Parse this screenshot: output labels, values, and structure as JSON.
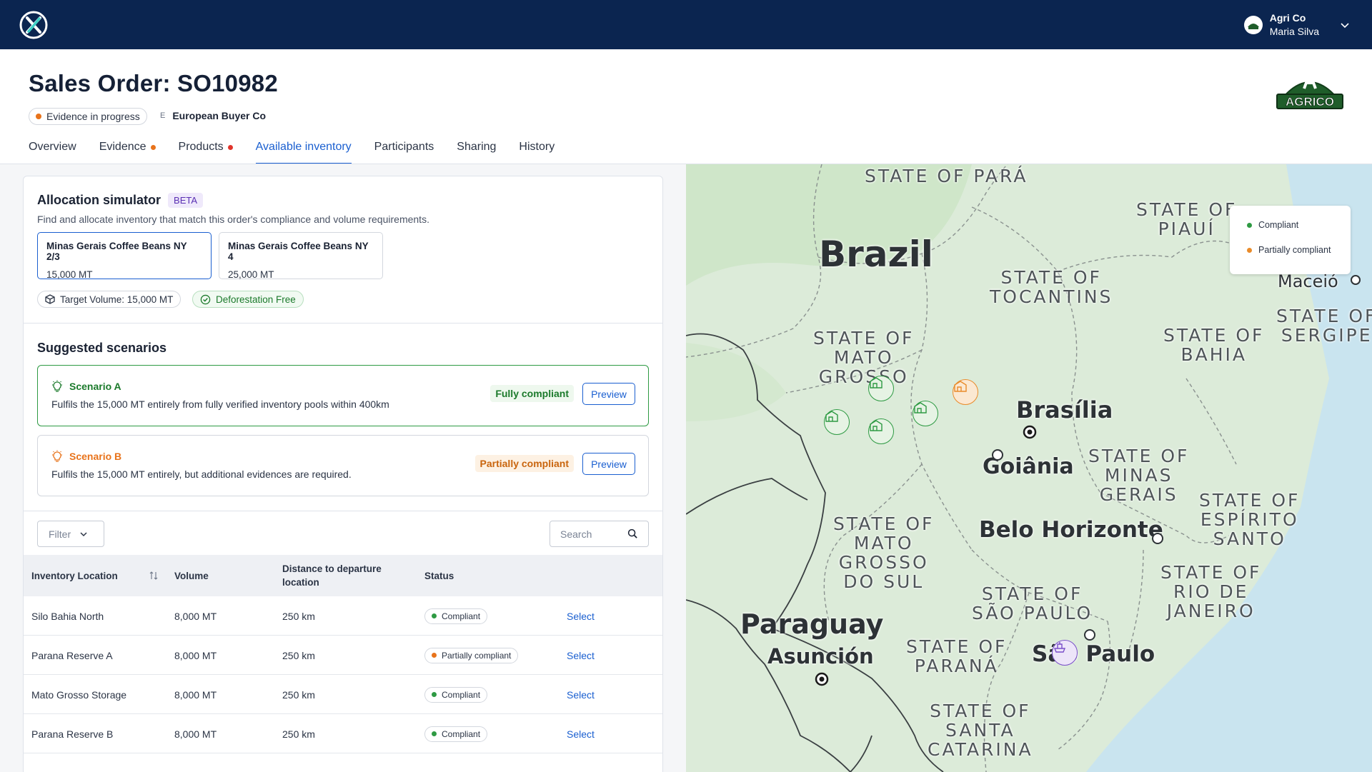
{
  "topbar": {
    "org_name": "Agri Co",
    "user_name": "Maria Silva",
    "icons": [
      "app-logo-icon",
      "org-avatar-icon",
      "chevron-down-icon"
    ]
  },
  "header": {
    "title": "Sales Order: SO10982",
    "status_label": "Evidence in progress",
    "status_color": "#e8731b",
    "buyer_initial": "E",
    "buyer_name": "European Buyer Co",
    "brand_logo_text": "AGRICO"
  },
  "tabs": [
    {
      "label": "Overview",
      "dot": null
    },
    {
      "label": "Evidence",
      "dot": "#e8731b"
    },
    {
      "label": "Products",
      "dot": "#e0342b"
    },
    {
      "label": "Available inventory",
      "dot": null,
      "active": true
    },
    {
      "label": "Participants",
      "dot": null
    },
    {
      "label": "Sharing",
      "dot": null
    },
    {
      "label": "History",
      "dot": null
    }
  ],
  "simulator": {
    "title": "Allocation simulator",
    "badge": "BETA",
    "description": "Find and allocate inventory that match this order's compliance and volume requirements.",
    "products": [
      {
        "name": "Minas Gerais Coffee Beans NY 2/3",
        "volume": "15,000 MT",
        "selected": true
      },
      {
        "name": "Minas Gerais Coffee Beans NY 4",
        "volume": "25,000 MT",
        "selected": false
      }
    ],
    "target_volume": "Target Volume: 15,000 MT",
    "deforestation": "Deforestation Free"
  },
  "suggested": {
    "title": "Suggested scenarios",
    "scenarios": [
      {
        "name": "Scenario A",
        "description": "Fulfils the 15,000 MT entirely from fully verified inventory pools within 400km",
        "compliance": "Fully compliant",
        "preview": "Preview",
        "color": "#1b7a2b"
      },
      {
        "name": "Scenario B",
        "description": "Fulfils the 15,000 MT entirely, but additional evidences are required.",
        "compliance": "Partially compliant",
        "preview": "Preview",
        "color": "#e8731b"
      }
    ]
  },
  "inventory": {
    "filter_label": "Filter",
    "search_placeholder": "Search",
    "columns": [
      "Inventory Location",
      "Volume",
      "Distance to departure location",
      "Status"
    ],
    "rows": [
      {
        "location": "Silo Bahia North",
        "volume": "8,000 MT",
        "distance": "250 km",
        "status": "Compliant",
        "status_color": "#2e9a43",
        "action": "Select"
      },
      {
        "location": "Parana Reserve A",
        "volume": "8,000 MT",
        "distance": "250 km",
        "status": "Partially compliant",
        "status_color": "#e8731b",
        "action": "Select"
      },
      {
        "location": "Mato Grosso Storage",
        "volume": "8,000 MT",
        "distance": "250 km",
        "status": "Compliant",
        "status_color": "#2e9a43",
        "action": "Select"
      },
      {
        "location": "Parana Reserve B",
        "volume": "8,000 MT",
        "distance": "250 km",
        "status": "Compliant",
        "status_color": "#2e9a43",
        "action": "Select"
      }
    ]
  },
  "map": {
    "legend": [
      {
        "label": "Compliant",
        "color": "#2e9a43"
      },
      {
        "label": "Partially compliant",
        "color": "#e8731b"
      }
    ],
    "country_labels": [
      "Brazil",
      "Paraguay"
    ],
    "state_labels": [
      "STATE OF PARÁ",
      "STATE OF\nPIAUÍ",
      "STATE OF\nTOCANTINS",
      "STATE OF\nMATO\nGROSSO",
      "STATE OF\nBAHIA",
      "STATE OF\nSERGIPE",
      "STATE OF\nMINAS\nGERAIS",
      "STATE OF\nESPÍRITO\nSANTO",
      "STATE OF\nMATO\nGROSSO\nDO SUL",
      "STATE OF\nRIO DE\nJANEIRO",
      "STATE OF\nSÃO PAULO",
      "STATE OF\nPARANÁ",
      "STATE OF\nSANTA\nCATARINA"
    ],
    "city_labels": [
      "Brasília",
      "Goiânia",
      "Belo Horizonte",
      "Asunción",
      "São Paulo",
      "Maceió"
    ]
  }
}
